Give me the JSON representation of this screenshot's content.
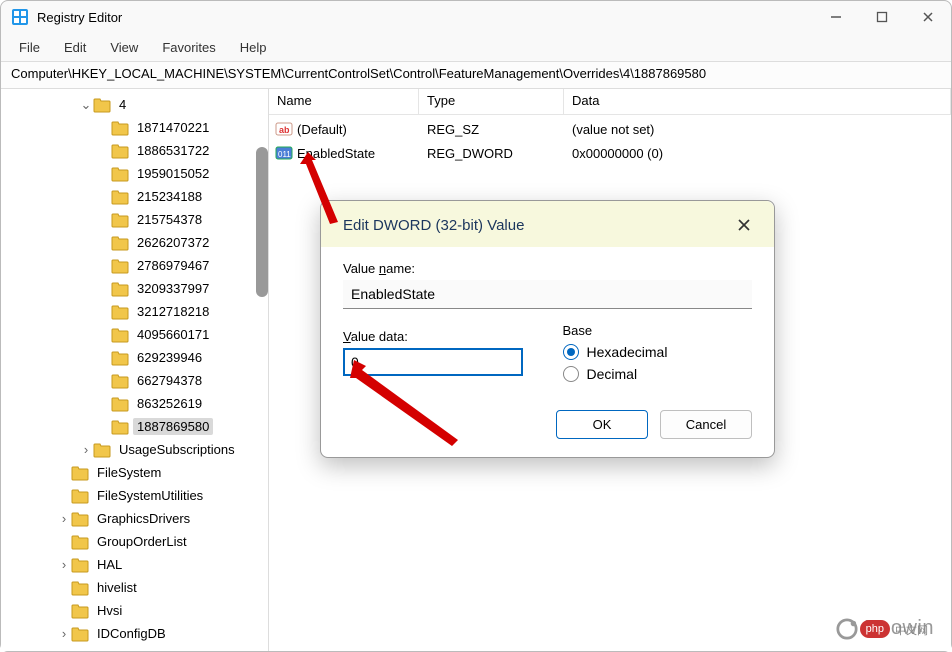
{
  "window": {
    "title": "Registry Editor"
  },
  "menubar": [
    "File",
    "Edit",
    "View",
    "Favorites",
    "Help"
  ],
  "address_path": "Computer\\HKEY_LOCAL_MACHINE\\SYSTEM\\CurrentControlSet\\Control\\FeatureManagement\\Overrides\\4\\1887869580",
  "tree": {
    "parent_label": "4",
    "children": [
      "1871470221",
      "1886531722",
      "1959015052",
      "215234188",
      "215754378",
      "2626207372",
      "2786979467",
      "3209337997",
      "3212718218",
      "4095660171",
      "629239946",
      "662794378",
      "863252619",
      "1887869580"
    ],
    "selected": "1887869580",
    "siblings_after": [
      "UsageSubscriptions",
      "FileSystem",
      "FileSystemUtilities",
      "GraphicsDrivers",
      "GroupOrderList",
      "HAL",
      "hivelist",
      "Hvsi",
      "IDConfigDB"
    ]
  },
  "columns": {
    "name": "Name",
    "type": "Type",
    "data": "Data"
  },
  "values": [
    {
      "icon": "str",
      "name": "(Default)",
      "type": "REG_SZ",
      "data": "(value not set)"
    },
    {
      "icon": "bin",
      "name": "EnabledState",
      "type": "REG_DWORD",
      "data": "0x00000000 (0)"
    }
  ],
  "dialog": {
    "title": "Edit DWORD (32-bit) Value",
    "name_label_prefix": "Value ",
    "name_label_ul": "n",
    "name_label_suffix": "ame:",
    "name_value": "EnabledState",
    "data_label_prefix": "",
    "data_label_ul": "V",
    "data_label_suffix": "alue data:",
    "data_value": "0",
    "base_legend": "Base",
    "radio_hex_prefix": "",
    "radio_hex_ul": "H",
    "radio_hex_suffix": "exadecimal",
    "radio_dec_prefix": "",
    "radio_dec_ul": "D",
    "radio_dec_suffix": "ecimal",
    "selected_base": "hex",
    "ok": "OK",
    "cancel": "Cancel"
  },
  "watermark": "Neowin"
}
